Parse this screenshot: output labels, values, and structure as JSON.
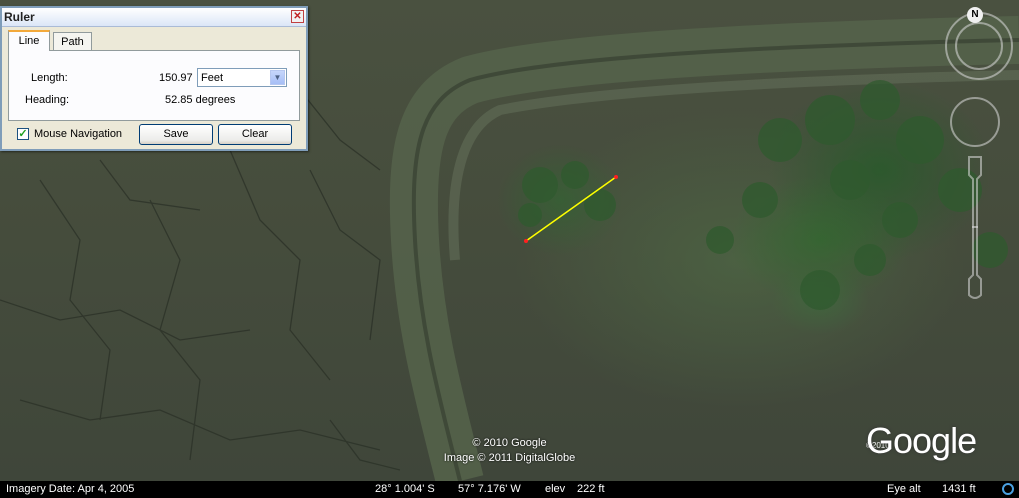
{
  "ruler": {
    "title": "Ruler",
    "close_glyph": "✕",
    "tabs": [
      {
        "label": "Line",
        "active": true
      },
      {
        "label": "Path",
        "active": false
      }
    ],
    "length_label": "Length:",
    "length_value": "150.97",
    "unit_selected": "Feet",
    "heading_label": "Heading:",
    "heading_value": "52.85 degrees",
    "mouse_nav_label": "Mouse Navigation",
    "mouse_nav_checked": true,
    "save_label": "Save",
    "clear_label": "Clear"
  },
  "nav": {
    "north_label": "N"
  },
  "credits": {
    "line1": "© 2010 Google",
    "line2": "Image © 2011 DigitalGlobe"
  },
  "logo": {
    "copyright": "©2010",
    "name": "Google"
  },
  "status": {
    "imagery_date": "Imagery Date: Apr  4, 2005",
    "latitude": "28° 1.004' S",
    "longitude": "57° 7.176' W",
    "elev_label": "elev",
    "elev_value": "222 ft",
    "eye_alt_label": "Eye alt",
    "eye_alt_value": "1431 ft"
  },
  "colors": {
    "measure_line": "#ffff00",
    "endpoint": "#ff2020",
    "tab_accent": "#f3a93b"
  },
  "icons": [
    "close-icon",
    "dropdown-arrow-icon",
    "checkbox-check-icon",
    "north-icon",
    "look-ring-icon",
    "move-ring-icon",
    "zoom-slider-icon",
    "streaming-icon"
  ]
}
